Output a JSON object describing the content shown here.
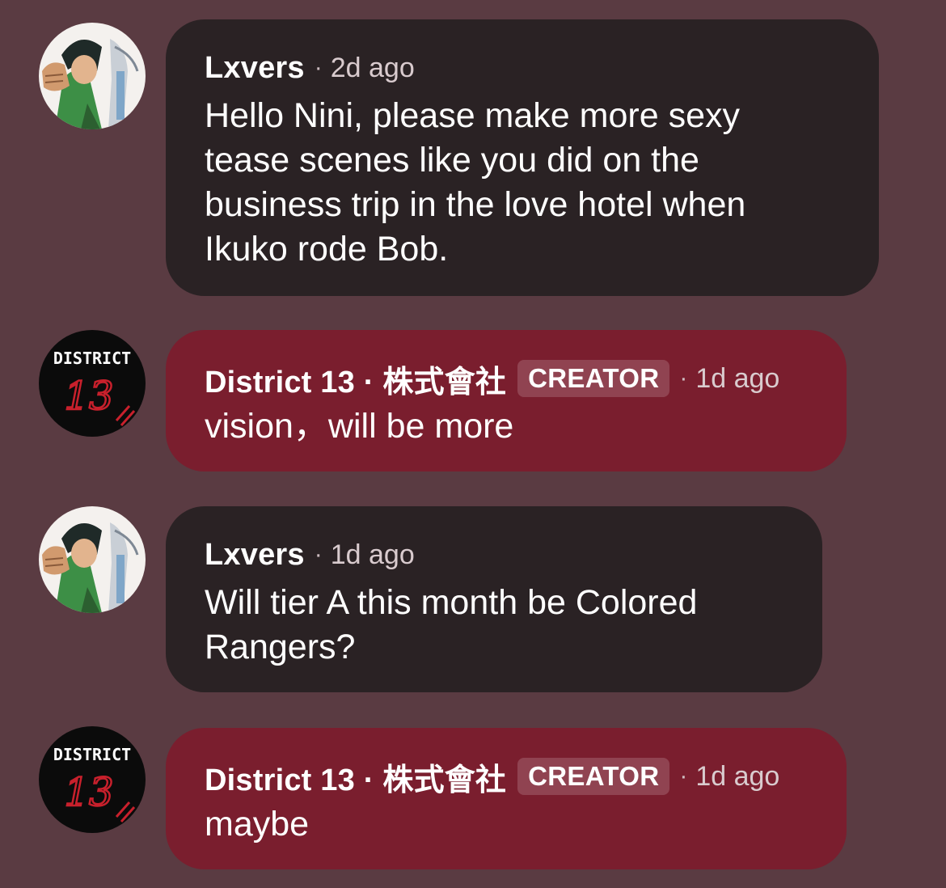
{
  "comments": [
    {
      "author": "Lxvers",
      "separator": "·",
      "time": "2d ago",
      "text": "Hello Nini, please make more sexy\ntease scenes like you did on the\nbusiness trip in the love hotel when\nIkuko rode Bob.",
      "avatar": "anime-character-avatar"
    },
    {
      "author": "District 13 · 株式會社",
      "badge": "CREATOR",
      "separator": "·",
      "time": "1d ago",
      "text": "vision，will be more",
      "avatar": "district-13-logo-avatar",
      "avatar_lettering": [
        "DISTRICT",
        "13"
      ]
    },
    {
      "author": "Lxvers",
      "separator": "·",
      "time": "1d ago",
      "text": "Will tier A this month be Colored\nRangers?",
      "avatar": "anime-character-avatar"
    },
    {
      "author": "District 13 · 株式會社",
      "badge": "CREATOR",
      "separator": "·",
      "time": "1d ago",
      "text": "maybe",
      "avatar": "district-13-logo-avatar",
      "avatar_lettering": [
        "DISTRICT",
        "13"
      ]
    }
  ],
  "colors": {
    "background": "#5a3b42",
    "user_bubble": "#2a2224",
    "creator_bubble": "#7a1e2e",
    "logo_red": "#c8202c"
  }
}
